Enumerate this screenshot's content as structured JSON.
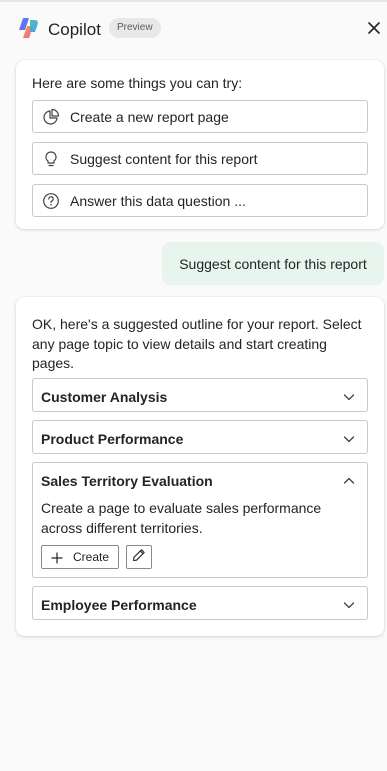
{
  "header": {
    "title": "Copilot",
    "badge": "Preview",
    "logo_icon": "copilot-logo-icon",
    "close_icon": "close-icon"
  },
  "suggestions_card": {
    "heading": "Here are some things you can try:",
    "items": [
      {
        "icon": "pie-chart-icon",
        "label": "Create a new report page"
      },
      {
        "icon": "lightbulb-icon",
        "label": "Suggest content for this report"
      },
      {
        "icon": "question-circle-icon",
        "label": "Answer this data question ..."
      }
    ]
  },
  "user_message": {
    "text": "Suggest content for this report",
    "bg_color": "#e8f5ee"
  },
  "response_card": {
    "intro": "OK, here's a suggested outline for your report. Select any page topic to view details and start creating pages.",
    "topics": [
      {
        "title": "Customer Analysis",
        "expanded": false
      },
      {
        "title": "Product Performance",
        "expanded": false
      },
      {
        "title": "Sales Territory Evaluation",
        "expanded": true,
        "description": "Create a page to evaluate sales performance across different territories.",
        "create_label": "Create"
      },
      {
        "title": "Employee Performance",
        "expanded": false
      }
    ]
  }
}
